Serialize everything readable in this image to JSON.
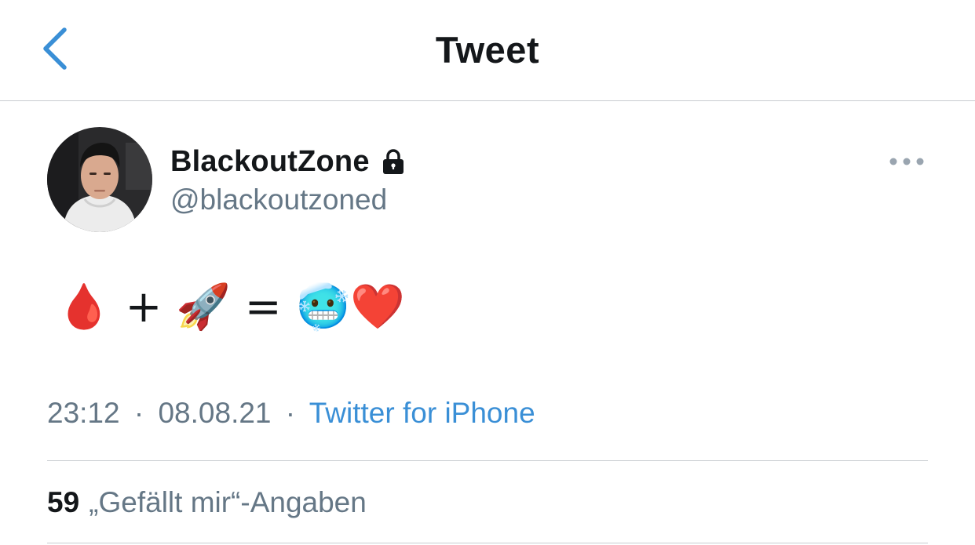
{
  "nav": {
    "title": "Tweet",
    "back_icon": "chevron-left-icon",
    "accent_color": "#3a8fd6"
  },
  "tweet": {
    "author": {
      "display_name": "BlackoutZone",
      "handle": "@blackoutzoned",
      "protected_icon": "lock-icon"
    },
    "more_icon": "more-horizontal-icon",
    "text": "🩸 + 🚀 = 🥶❤️",
    "time": "23:12",
    "date": "08.08.21",
    "separator": "·",
    "source": "Twitter for iPhone",
    "likes": {
      "count": "59",
      "label": "„Gefällt mir“-Angaben"
    }
  }
}
